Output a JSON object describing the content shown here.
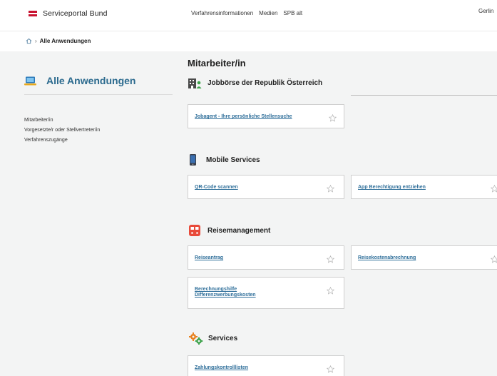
{
  "header": {
    "brand": "Serviceportal Bund",
    "nav": [
      "Verfahrensinformationen",
      "Medien",
      "SPB alt"
    ],
    "user": "Gerlin"
  },
  "breadcrumb": {
    "current": "Alle Anwendungen"
  },
  "sidebar": {
    "title": "Alle Anwendungen",
    "items": [
      {
        "label": "Mitarbeiter/in"
      },
      {
        "label": "Vorgesetzte/r oder Stellvertreter/in"
      },
      {
        "label": "Verfahrenszugänge"
      }
    ]
  },
  "main": {
    "title": "Mitarbeiter/in",
    "sections": [
      {
        "title": "Jobbörse der Republik Österreich",
        "icon": "building-person-icon",
        "apps": [
          "Jobagent - Ihre persönliche Stellensuche"
        ]
      },
      {
        "title": "Mobile Services",
        "icon": "smartphone-icon",
        "apps": [
          "QR-Code scannen",
          "App Berechtigung entziehen"
        ]
      },
      {
        "title": "Reisemanagement",
        "icon": "train-icon",
        "apps": [
          "Reiseantrag",
          "Reisekostenabrechnung",
          "Berechnungshilfe",
          "Differenzwerbungskosten"
        ]
      },
      {
        "title": "Services",
        "icon": "gears-icon",
        "apps": [
          "Zahlungskontrolllisten"
        ]
      }
    ]
  },
  "colors": {
    "brand_red": "#c8102e",
    "link_blue": "#2f6f9a",
    "sidebar_title": "#2b6a8e",
    "band_gray": "#f3f4f4"
  }
}
